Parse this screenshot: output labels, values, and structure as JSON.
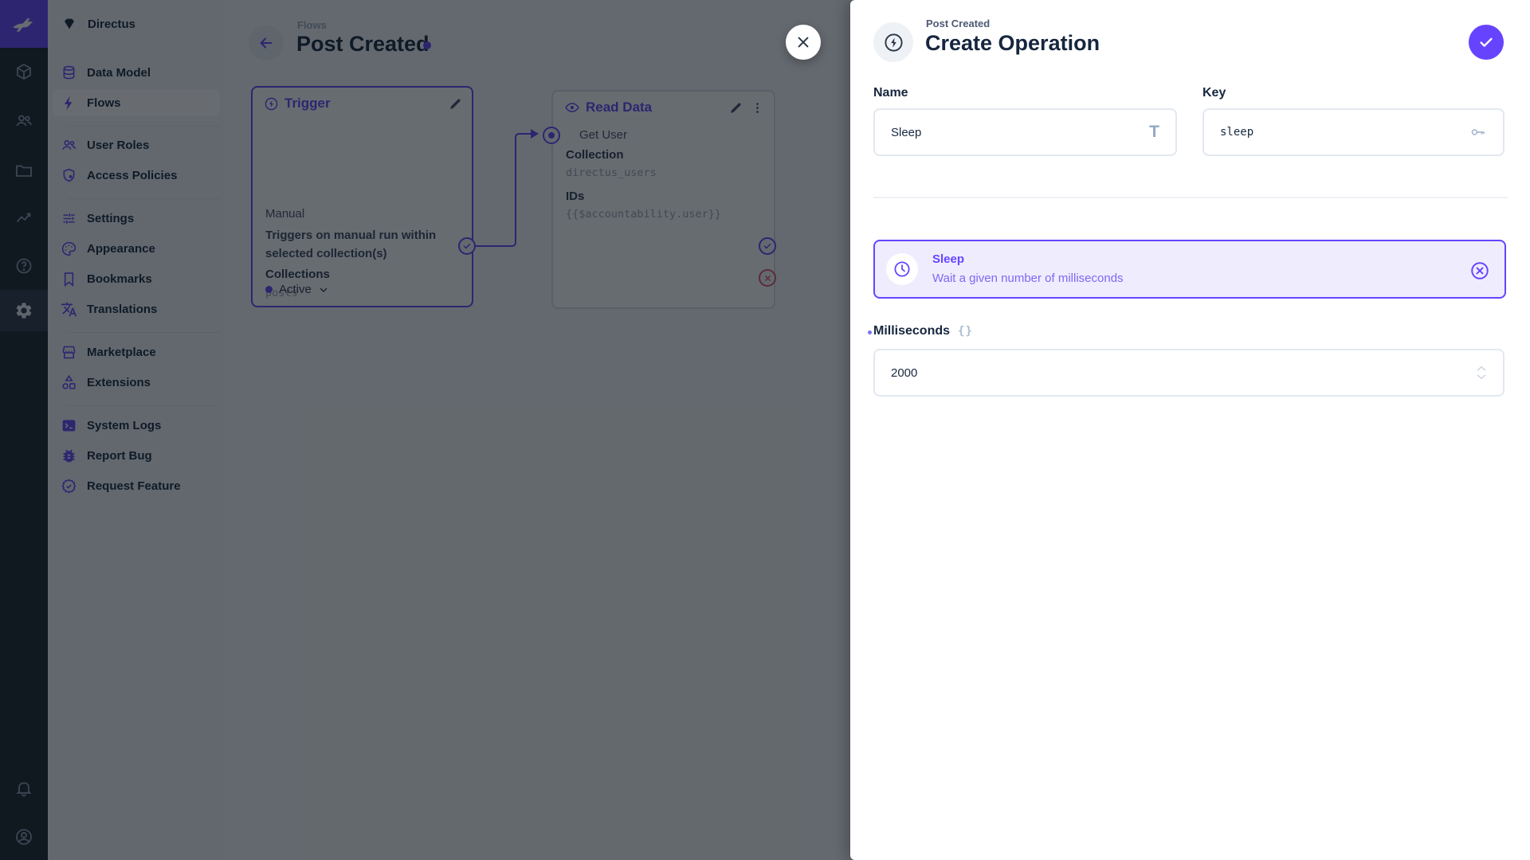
{
  "colors": {
    "accent": "#6644ff",
    "navy": "#172940",
    "reject": "#e0556d",
    "module_bar": "#18222f"
  },
  "module_bar": {
    "modules": [
      "logo",
      "data-model",
      "user-directory",
      "file-library",
      "insights",
      "documentation",
      "settings"
    ],
    "active_module": "settings",
    "bottom": [
      "notifications",
      "user-avatar"
    ]
  },
  "nav": {
    "project_name": "Directus",
    "items": [
      {
        "label": "Data Model",
        "icon": "database"
      },
      {
        "label": "Flows",
        "icon": "bolt",
        "active": true
      },
      {
        "label": "User Roles",
        "icon": "people"
      },
      {
        "label": "Access Policies",
        "icon": "shield-lock"
      },
      {
        "label": "Settings",
        "icon": "tune"
      },
      {
        "label": "Appearance",
        "icon": "palette"
      },
      {
        "label": "Bookmarks",
        "icon": "bookmark"
      },
      {
        "label": "Translations",
        "icon": "translate"
      },
      {
        "label": "Marketplace",
        "icon": "storefront"
      },
      {
        "label": "Extensions",
        "icon": "category"
      },
      {
        "label": "System Logs",
        "icon": "terminal"
      },
      {
        "label": "Report Bug",
        "icon": "bug"
      },
      {
        "label": "Request Feature",
        "icon": "new-releases"
      }
    ]
  },
  "flow": {
    "breadcrumb": "Flows",
    "title": "Post Created",
    "trigger_panel": {
      "title": "Trigger",
      "type": "Manual",
      "description": "Triggers on manual run within selected collection(s)",
      "field_label": "Collections",
      "field_value": "posts",
      "status": "Active"
    },
    "operation_panel": {
      "title": "Read Data",
      "name": "Get User",
      "collection_label": "Collection",
      "collection_value": "directus_users",
      "ids_label": "IDs",
      "ids_value": "{{$accountability.user}}"
    }
  },
  "drawer": {
    "breadcrumb": "Post Created",
    "title": "Create Operation",
    "name_field": {
      "label": "Name",
      "value": "Sleep",
      "icon_glyph": "T"
    },
    "key_field": {
      "label": "Key",
      "value": "sleep"
    },
    "operation_card": {
      "name": "Sleep",
      "description": "Wait a given number of milliseconds"
    },
    "milliseconds_field": {
      "label": "Milliseconds",
      "value": "2000",
      "raw_icon_glyph": "{}"
    }
  }
}
